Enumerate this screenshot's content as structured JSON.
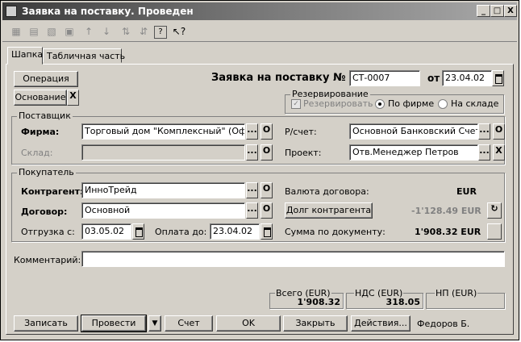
{
  "window": {
    "title": "Заявка на поставку. Проведен",
    "min_label": "_",
    "max_label": "□",
    "close_label": "X"
  },
  "toolbar": {
    "icons": [
      "▦",
      "▤",
      "▧",
      "▣",
      "↑",
      "↓",
      "⇅",
      "⇵",
      "?",
      "↖?"
    ]
  },
  "tabs": [
    "Шапка",
    "Табличная часть"
  ],
  "header": {
    "operation_button": "Операция",
    "basis_button": "Основание",
    "basis_clear": "X",
    "doc_title": "Заявка на поставку №",
    "doc_number": "СТ-0007",
    "from_label": "от",
    "doc_date": "23.04.02"
  },
  "reservation": {
    "caption": "Резервирование",
    "reserve_label": "Резервировать",
    "by_company_label": "По фирме",
    "by_warehouse_label": "На складе"
  },
  "supplier": {
    "caption": "Поставщик",
    "firm_label": "Фирма:",
    "firm_value": "Торговый дом \"Комплексный\" (Офис)",
    "warehouse_label": "Склад:",
    "warehouse_value": "",
    "account_label": "Р/счет:",
    "account_value": "Основной Банковский Счет",
    "project_label": "Проект:",
    "project_value": "Отв.Менеджер Петров"
  },
  "buyer": {
    "caption": "Покупатель",
    "counterparty_label": "Контрагент:",
    "counterparty_value": "ИнноТрейд",
    "contract_label": "Договор:",
    "contract_value": "Основной",
    "shipment_label": "Отгрузка с:",
    "shipment_date": "03.05.02",
    "payment_label": "Оплата до:",
    "payment_date": "23.04.02",
    "currency_label": "Валюта договора:",
    "currency_value": "EUR",
    "debt_button": "Долг контрагента",
    "debt_value": "-1'128.49 EUR",
    "doc_sum_label": "Сумма по документу:",
    "doc_sum_value": "1'908.32 EUR"
  },
  "comment": {
    "label": "Комментарий:",
    "value": ""
  },
  "totals": {
    "total_label": "Всего (EUR)",
    "total_value": "1'908.32",
    "vat_label": "НДС (EUR)",
    "vat_value": "318.05",
    "sales_tax_label": "НП (EUR)",
    "sales_tax_value": ""
  },
  "small_buttons": {
    "select": "...",
    "open": "O",
    "clear": "X",
    "dropdown": "▼"
  },
  "footer": {
    "save": "Записать",
    "post": "Провести",
    "invoice": "Счет",
    "ok": "OK",
    "close": "Закрыть",
    "actions": "Действия...",
    "user": "Федоров Б."
  }
}
